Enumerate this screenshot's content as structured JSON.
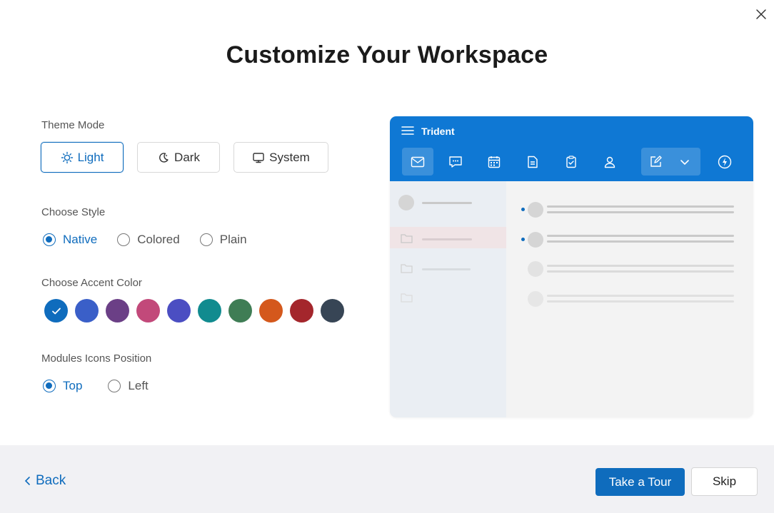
{
  "dialog": {
    "title": "Customize Your Workspace",
    "close_icon": "close-icon"
  },
  "theme_mode": {
    "label": "Theme Mode",
    "options": [
      {
        "label": "Light",
        "icon": "sun-icon",
        "selected": true
      },
      {
        "label": "Dark",
        "icon": "moon-icon",
        "selected": false
      },
      {
        "label": "System",
        "icon": "monitor-icon",
        "selected": false
      }
    ]
  },
  "style": {
    "label": "Choose Style",
    "options": [
      {
        "label": "Native",
        "selected": true
      },
      {
        "label": "Colored",
        "selected": false
      },
      {
        "label": "Plain",
        "selected": false
      }
    ]
  },
  "accent": {
    "label": "Choose Accent Color",
    "colors": [
      "#0f6cbd",
      "#3a5fc8",
      "#6b3f86",
      "#c2497a",
      "#4b4ec2",
      "#118b8f",
      "#3f7d55",
      "#d4581c",
      "#a4262c",
      "#374555"
    ],
    "selected_index": 0
  },
  "icons_position": {
    "label": "Modules Icons Position",
    "options": [
      {
        "label": "Top",
        "selected": true
      },
      {
        "label": "Left",
        "selected": false
      }
    ]
  },
  "preview": {
    "app_name": "Trident",
    "header_color": "#0f78d4",
    "module_icons": [
      "mail-icon",
      "chat-icon",
      "calendar-icon",
      "notes-icon",
      "tasks-icon",
      "contacts-icon",
      "compose-icon",
      "chevron-down-icon",
      "lightning-icon"
    ]
  },
  "footer": {
    "back_label": "Back",
    "tour_label": "Take a Tour",
    "skip_label": "Skip"
  },
  "colors": {
    "accent": "#0f6cbd"
  }
}
